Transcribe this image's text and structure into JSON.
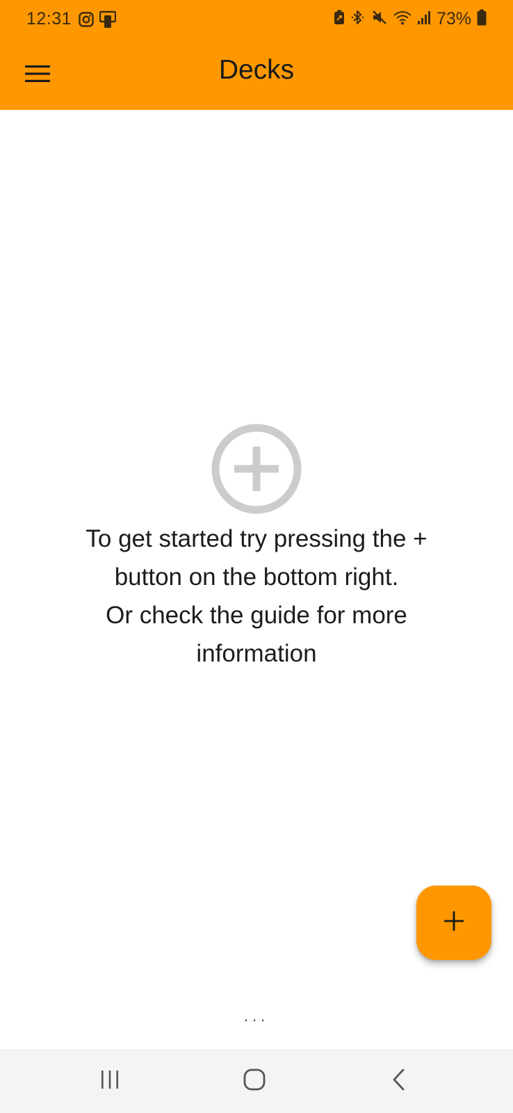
{
  "status_bar": {
    "time": "12:31",
    "battery": "73%",
    "left_icons": [
      "instagram-icon",
      "phone-link-icon"
    ],
    "right_icons": [
      "battery-saver-icon",
      "bluetooth-icon",
      "muted-icon",
      "wifi-icon",
      "signal-icon",
      "battery-icon"
    ]
  },
  "app_bar": {
    "title": "Decks",
    "menu_icon": "hamburger-menu-icon"
  },
  "empty_state": {
    "icon": "add-circle-icon",
    "line1": "To get started try pressing the +",
    "line2": "button on the bottom right.",
    "line3": "Or check the guide for more",
    "line4": "information"
  },
  "fab": {
    "icon": "plus-icon"
  },
  "ellipsis": "...",
  "nav_bar": {
    "buttons": [
      "recent-apps-icon",
      "home-icon",
      "back-icon"
    ]
  },
  "colors": {
    "accent": "#ff9800",
    "background": "#ffffff",
    "nav_background": "#f3f4f6",
    "empty_icon": "#cccccc"
  }
}
